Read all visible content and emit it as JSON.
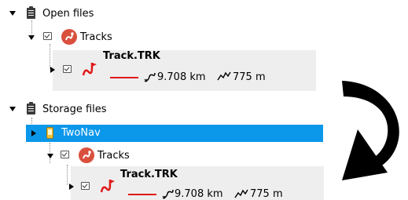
{
  "tree": {
    "open_files": {
      "label": "Open files",
      "tracks_label": "Tracks",
      "track": {
        "name": "Track.TRK",
        "distance": "9.708 km",
        "elevation": "775 m"
      }
    },
    "storage_files": {
      "label": "Storage files",
      "device_label": "TwoNav",
      "tracks_label": "Tracks",
      "track": {
        "name": "Track.TRK",
        "distance": "9.708 km",
        "elevation": "775 m"
      }
    }
  },
  "colors": {
    "selection": "#0b97ea",
    "track_line": "#e01818",
    "tracks_icon": "#d9503d",
    "panel_bg": "#eeeeee"
  },
  "icons": [
    "folder-icon",
    "checkbox-icon",
    "tracks-icon",
    "track-route-icon",
    "distance-icon",
    "elevation-icon",
    "device-icon",
    "chevron-right-icon",
    "chevron-down-icon",
    "curved-arrow-icon"
  ]
}
